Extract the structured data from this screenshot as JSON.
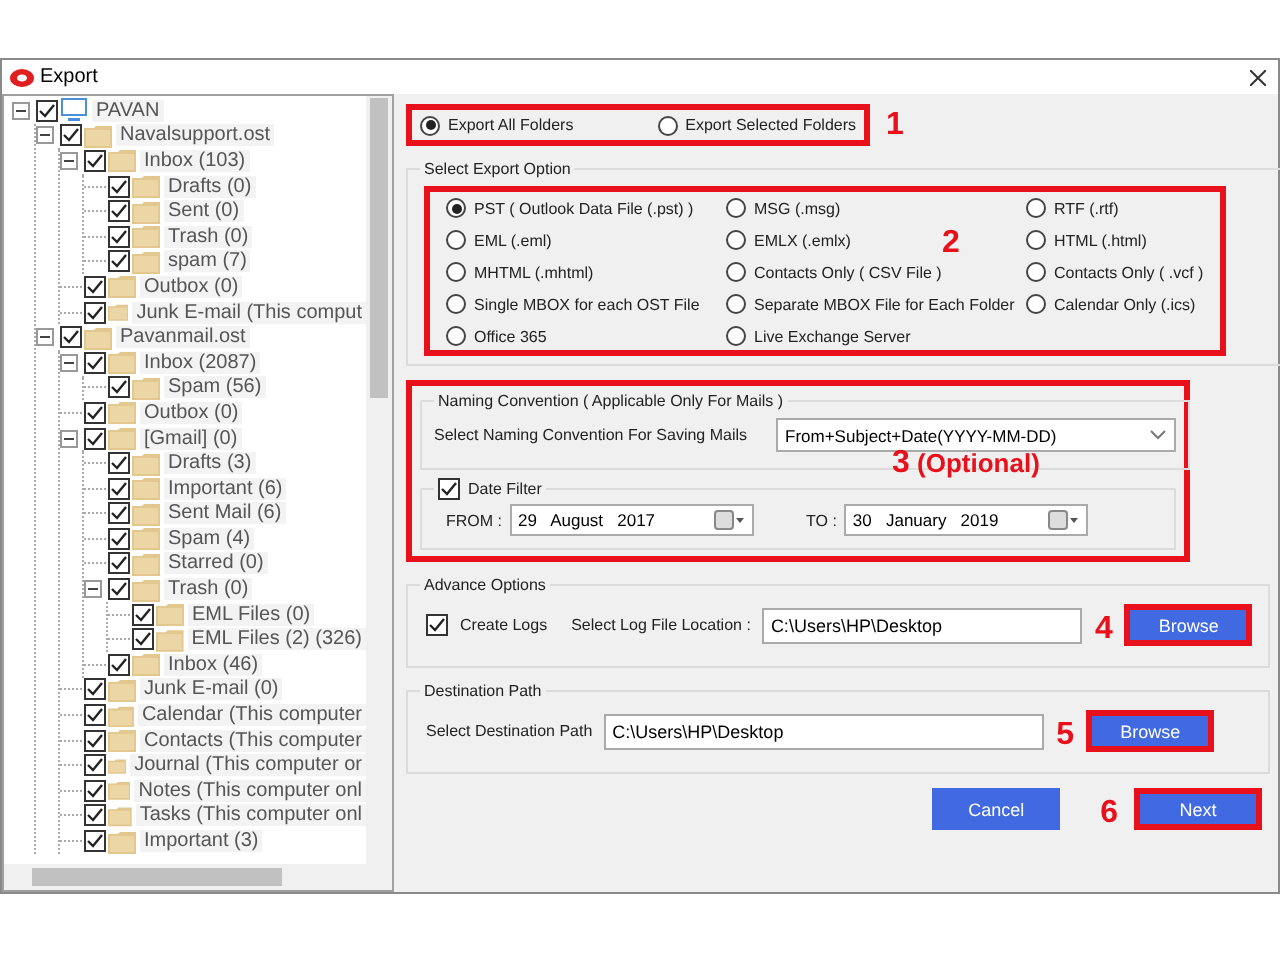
{
  "window": {
    "title": "Export"
  },
  "folder_tree": [
    {
      "label": "PAVAN",
      "kind": "computer",
      "checked": true,
      "expanded": true,
      "children": [
        {
          "label": "Navalsupport.ost",
          "kind": "folder",
          "checked": true,
          "expanded": true,
          "children": [
            {
              "label": "Inbox (103)",
              "kind": "folder",
              "checked": true,
              "expanded": true,
              "children": [
                {
                  "label": "Drafts (0)",
                  "kind": "folder",
                  "checked": true
                },
                {
                  "label": "Sent (0)",
                  "kind": "folder",
                  "checked": true
                },
                {
                  "label": "Trash (0)",
                  "kind": "folder",
                  "checked": true
                },
                {
                  "label": "spam (7)",
                  "kind": "folder",
                  "checked": true
                }
              ]
            },
            {
              "label": "Outbox (0)",
              "kind": "folder",
              "checked": true
            },
            {
              "label": "Junk E-mail (This comput",
              "kind": "folder",
              "checked": true
            }
          ]
        },
        {
          "label": "Pavanmail.ost",
          "kind": "folder",
          "checked": true,
          "expanded": true,
          "children": [
            {
              "label": "Inbox (2087)",
              "kind": "folder",
              "checked": true,
              "expanded": true,
              "children": [
                {
                  "label": "Spam (56)",
                  "kind": "folder",
                  "checked": true
                }
              ]
            },
            {
              "label": "Outbox (0)",
              "kind": "folder",
              "checked": true
            },
            {
              "label": "[Gmail] (0)",
              "kind": "folder",
              "checked": true,
              "expanded": true,
              "children": [
                {
                  "label": "Drafts (3)",
                  "kind": "folder",
                  "checked": true
                },
                {
                  "label": "Important (6)",
                  "kind": "folder",
                  "checked": true
                },
                {
                  "label": "Sent Mail (6)",
                  "kind": "folder",
                  "checked": true
                },
                {
                  "label": "Spam (4)",
                  "kind": "folder",
                  "checked": true
                },
                {
                  "label": "Starred (0)",
                  "kind": "folder",
                  "checked": true
                },
                {
                  "label": "Trash (0)",
                  "kind": "folder",
                  "checked": true,
                  "expanded": true,
                  "children": [
                    {
                      "label": "EML Files (0)",
                      "kind": "folder",
                      "checked": true
                    },
                    {
                      "label": "EML Files (2) (326)",
                      "kind": "folder",
                      "checked": true
                    }
                  ]
                },
                {
                  "label": "Inbox (46)",
                  "kind": "folder",
                  "checked": true
                }
              ]
            },
            {
              "label": "Junk E-mail (0)",
              "kind": "folder",
              "checked": true
            },
            {
              "label": "Calendar (This computer",
              "kind": "folder",
              "checked": true
            },
            {
              "label": "Contacts (This computer",
              "kind": "folder",
              "checked": true
            },
            {
              "label": "Journal (This computer or",
              "kind": "folder",
              "checked": true
            },
            {
              "label": "Notes (This computer onl",
              "kind": "folder",
              "checked": true
            },
            {
              "label": "Tasks (This computer onl",
              "kind": "folder",
              "checked": true
            },
            {
              "label": "Important (3)",
              "kind": "folder",
              "checked": true
            }
          ]
        }
      ]
    }
  ],
  "export_scope": {
    "step": "1",
    "options": [
      {
        "label": "Export All Folders",
        "selected": true
      },
      {
        "label": "Export Selected Folders",
        "selected": false
      }
    ]
  },
  "export_option": {
    "title": "Select Export Option",
    "step": "2",
    "options": [
      {
        "label": "PST ( Outlook Data File (.pst) )",
        "selected": true
      },
      {
        "label": "MSG  (.msg)",
        "selected": false
      },
      {
        "label": "RTF  (.rtf)",
        "selected": false
      },
      {
        "label": "EML  (.eml)",
        "selected": false
      },
      {
        "label": "EMLX  (.emlx)",
        "selected": false
      },
      {
        "label": "HTML  (.html)",
        "selected": false
      },
      {
        "label": "MHTML (.mhtml)",
        "selected": false
      },
      {
        "label": "Contacts Only  ( CSV File )",
        "selected": false
      },
      {
        "label": "Contacts Only  ( .vcf )",
        "selected": false
      },
      {
        "label": "Single MBOX for each OST File",
        "selected": false
      },
      {
        "label": "Separate MBOX File for Each Folder",
        "selected": false
      },
      {
        "label": "Calendar Only  (.ics)",
        "selected": false
      },
      {
        "label": "Office 365",
        "selected": false
      },
      {
        "label": "Live Exchange Server",
        "selected": false
      }
    ]
  },
  "naming": {
    "title": "Naming Convention ( Applicable Only For Mails )",
    "label": "Select Naming Convention For Saving Mails",
    "value": "From+Subject+Date(YYYY-MM-DD)"
  },
  "date_filter": {
    "label": "Date Filter",
    "checked": true,
    "from_label": "FROM :",
    "from": "29   August   2017",
    "to_label": "TO :",
    "to": "30   January   2019"
  },
  "step3": {
    "number": "3",
    "note": "(Optional)"
  },
  "advance": {
    "title": "Advance Options",
    "create_logs": {
      "label": "Create Logs",
      "checked": true
    },
    "location_label": "Select Log File Location :",
    "location": "C:\\Users\\HP\\Desktop",
    "button": {
      "label": "Browse",
      "highlighted": true
    },
    "step": "4"
  },
  "destination": {
    "title": "Destination Path",
    "label": "Select Destination Path",
    "value": "C:\\Users\\HP\\Desktop",
    "button": {
      "label": "Browse",
      "highlighted": true
    },
    "step": "5"
  },
  "buttons": [
    {
      "label": "Cancel",
      "highlighted": false
    },
    {
      "label": "Next",
      "highlighted": true,
      "step": "6"
    }
  ]
}
